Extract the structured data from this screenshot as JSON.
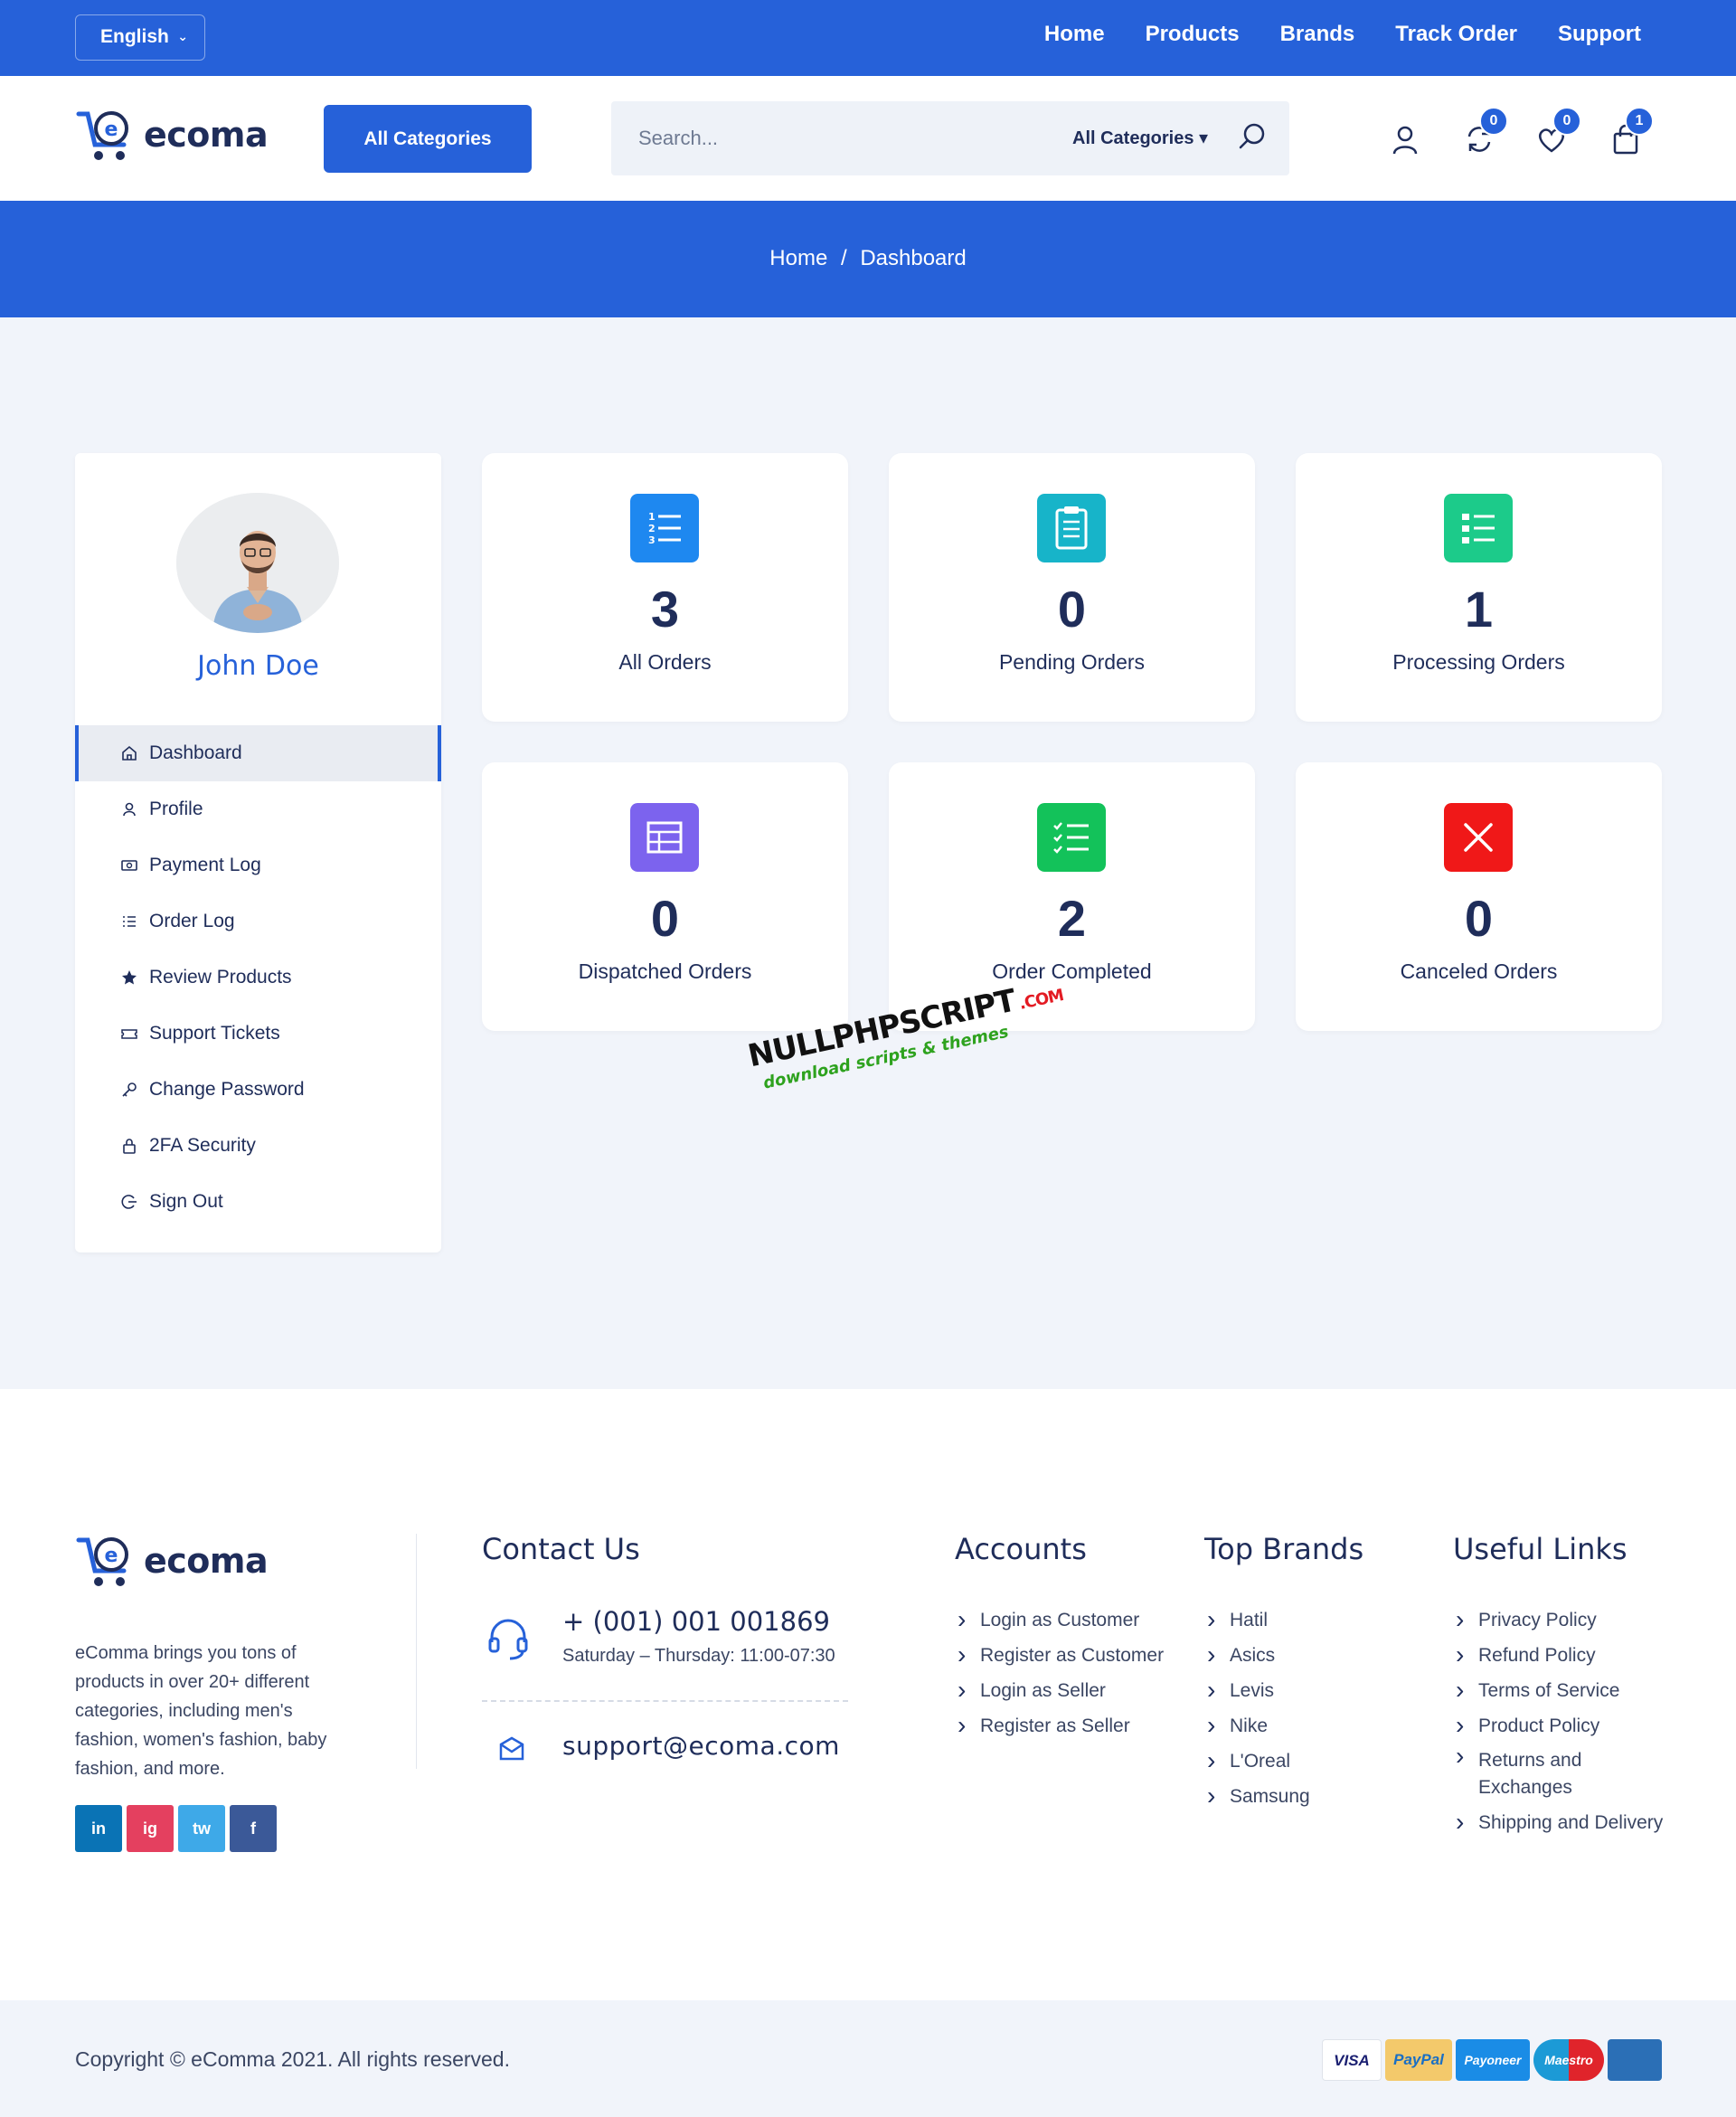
{
  "topbar": {
    "language": "English",
    "nav": [
      "Home",
      "Products",
      "Brands",
      "Track Order",
      "Support"
    ]
  },
  "header": {
    "logo_text": "ecoma",
    "all_categories_button": "All Categories",
    "search_placeholder": "Search...",
    "search_category": "All Categories",
    "compare_count": "0",
    "wishlist_count": "0",
    "cart_count": "1"
  },
  "breadcrumb": {
    "home": "Home",
    "separator": "/",
    "current": "Dashboard"
  },
  "profile": {
    "name": "John Doe",
    "menu": [
      {
        "label": "Dashboard",
        "icon": "home-icon",
        "active": true
      },
      {
        "label": "Profile",
        "icon": "user-icon"
      },
      {
        "label": "Payment Log",
        "icon": "money-icon"
      },
      {
        "label": "Order Log",
        "icon": "list-icon"
      },
      {
        "label": "Review Products",
        "icon": "star-icon"
      },
      {
        "label": "Support Tickets",
        "icon": "ticket-icon"
      },
      {
        "label": "Change Password",
        "icon": "key-icon"
      },
      {
        "label": "2FA Security",
        "icon": "lock-icon"
      },
      {
        "label": "Sign Out",
        "icon": "sign-out-icon"
      }
    ]
  },
  "stats": [
    {
      "value": "3",
      "label": "All Orders",
      "color": "#1e88f0",
      "icon": "numbered-list-icon"
    },
    {
      "value": "0",
      "label": "Pending Orders",
      "color": "#17b4c9",
      "icon": "clipboard-icon"
    },
    {
      "value": "1",
      "label": "Processing Orders",
      "color": "#1ccb8a",
      "icon": "list-icon"
    },
    {
      "value": "0",
      "label": "Dispatched Orders",
      "color": "#7c63ee",
      "icon": "table-icon"
    },
    {
      "value": "2",
      "label": "Order Completed",
      "color": "#13c25a",
      "icon": "checklist-icon"
    },
    {
      "value": "0",
      "label": "Canceled Orders",
      "color": "#f01818",
      "icon": "close-icon"
    }
  ],
  "watermark": {
    "main": "NULLPHPSCRIPT",
    "domain": ".COM",
    "tagline": "download scripts & themes"
  },
  "footer": {
    "about": "eComma brings you tons of products in over 20+ different categories, including men's fashion, women's fashion, baby fashion, and more.",
    "social": [
      "in",
      "ig",
      "tw",
      "f"
    ],
    "contact": {
      "title": "Contact Us",
      "phone": "+ (001) 001 001869",
      "hours": "Saturday – Thursday: 11:00-07:30",
      "email": "support@ecoma.com"
    },
    "accounts": {
      "title": "Accounts",
      "links": [
        "Login as Customer",
        "Register as Customer",
        "Login as Seller",
        "Register as Seller"
      ]
    },
    "brands": {
      "title": "Top Brands",
      "links": [
        "Hatil",
        "Asics",
        "Levis",
        "Nike",
        "L'Oreal",
        "Samsung"
      ]
    },
    "useful": {
      "title": "Useful Links",
      "links": [
        "Privacy Policy",
        "Refund Policy",
        "Terms of Service",
        "Product Policy",
        "Returns and Exchanges",
        "Shipping and Delivery"
      ]
    }
  },
  "bottom": {
    "copyright": "Copyright © eComma 2021. All rights reserved.",
    "payments": [
      "VISA",
      "PayPal",
      "Payoneer",
      "Maestro",
      ""
    ]
  }
}
